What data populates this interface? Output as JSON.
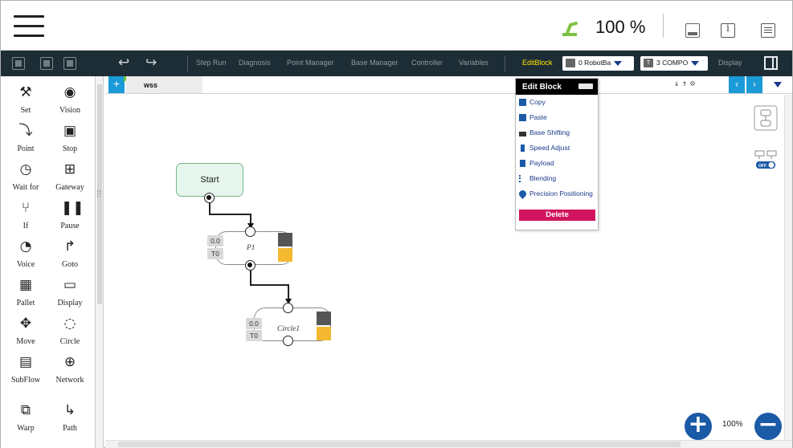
{
  "topbar": {
    "speed": "100 %"
  },
  "toolbar": {
    "items": [
      "Step Run",
      "Diagnosis",
      "Point Manager",
      "Base Manager",
      "Controller",
      "Variables"
    ],
    "editblock": "EditBlock",
    "robot_base": "0 RobotBa",
    "tool": "3 COMPO",
    "tool_prefix": "T",
    "display": "Display",
    "accent_color": "#ffe500"
  },
  "palette": [
    {
      "label": "Set",
      "icon": "wrench-icon"
    },
    {
      "label": "Vision",
      "icon": "eye-icon"
    },
    {
      "label": "Point",
      "icon": "point-icon"
    },
    {
      "label": "Stop",
      "icon": "stop-icon"
    },
    {
      "label": "Wait for",
      "icon": "clock-icon"
    },
    {
      "label": "Gateway",
      "icon": "gateway-icon"
    },
    {
      "label": "If",
      "icon": "branch-icon"
    },
    {
      "label": "Pause",
      "icon": "pause-icon"
    },
    {
      "label": "Voice",
      "icon": "voice-icon"
    },
    {
      "label": "Goto",
      "icon": "goto-icon"
    },
    {
      "label": "Pallet",
      "icon": "grid-icon"
    },
    {
      "label": "Display",
      "icon": "display-icon"
    },
    {
      "label": "Move",
      "icon": "move-icon"
    },
    {
      "label": "Circle",
      "icon": "circle-icon"
    },
    {
      "label": "SubFlow",
      "icon": "subflow-icon"
    },
    {
      "label": "Network",
      "icon": "globe-icon"
    },
    {
      "label": "Warp",
      "icon": "warp-icon"
    },
    {
      "label": "Path",
      "icon": "path-icon"
    }
  ],
  "tabs": {
    "add": "+",
    "active": "wss"
  },
  "flow": {
    "start": "Start",
    "p1": {
      "label": "P1",
      "speed": "0.0",
      "tool": "T0"
    },
    "circle1": {
      "label": "Circle1",
      "speed": "0.0",
      "tool": "T0"
    }
  },
  "editblock": {
    "title": "Edit Block",
    "items": [
      "Copy",
      "Paste",
      "Base Shifting",
      "Speed Adjust",
      "Payload",
      "Blending",
      "Precision Positioning"
    ],
    "delete": "Delete",
    "delete_color": "#d1165f"
  },
  "zoom": {
    "level": "100%"
  },
  "right_tools": {
    "toggle_state": "OFF"
  }
}
